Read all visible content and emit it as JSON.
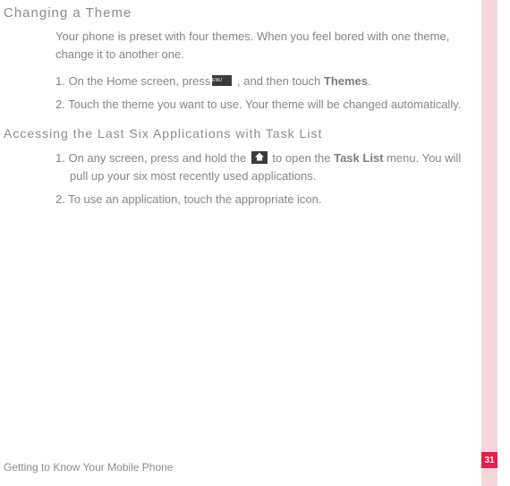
{
  "section1": {
    "title": "Changing a Theme",
    "intro": "Your phone is preset with four themes. When you feel bored with one theme, change it to another one.",
    "step1_a": "1. On the Home screen, press",
    "step1_b": " , and then touch ",
    "step1_themes": "Themes",
    "step1_c": ".",
    "step2": "2. Touch the theme you want to use. Your theme will be changed automatically."
  },
  "section2": {
    "title": "Accessing the Last Six Applications with Task List",
    "step1_a": "1. On any screen, press and hold the ",
    "step1_b": " to open the ",
    "step1_tasklist": "Task List",
    "step1_c": " menu. You will pull up your six most recently used applications.",
    "step2": "2. To use an application, touch the appropriate icon."
  },
  "footer": "Getting to Know Your Mobile Phone",
  "page_number": "31"
}
